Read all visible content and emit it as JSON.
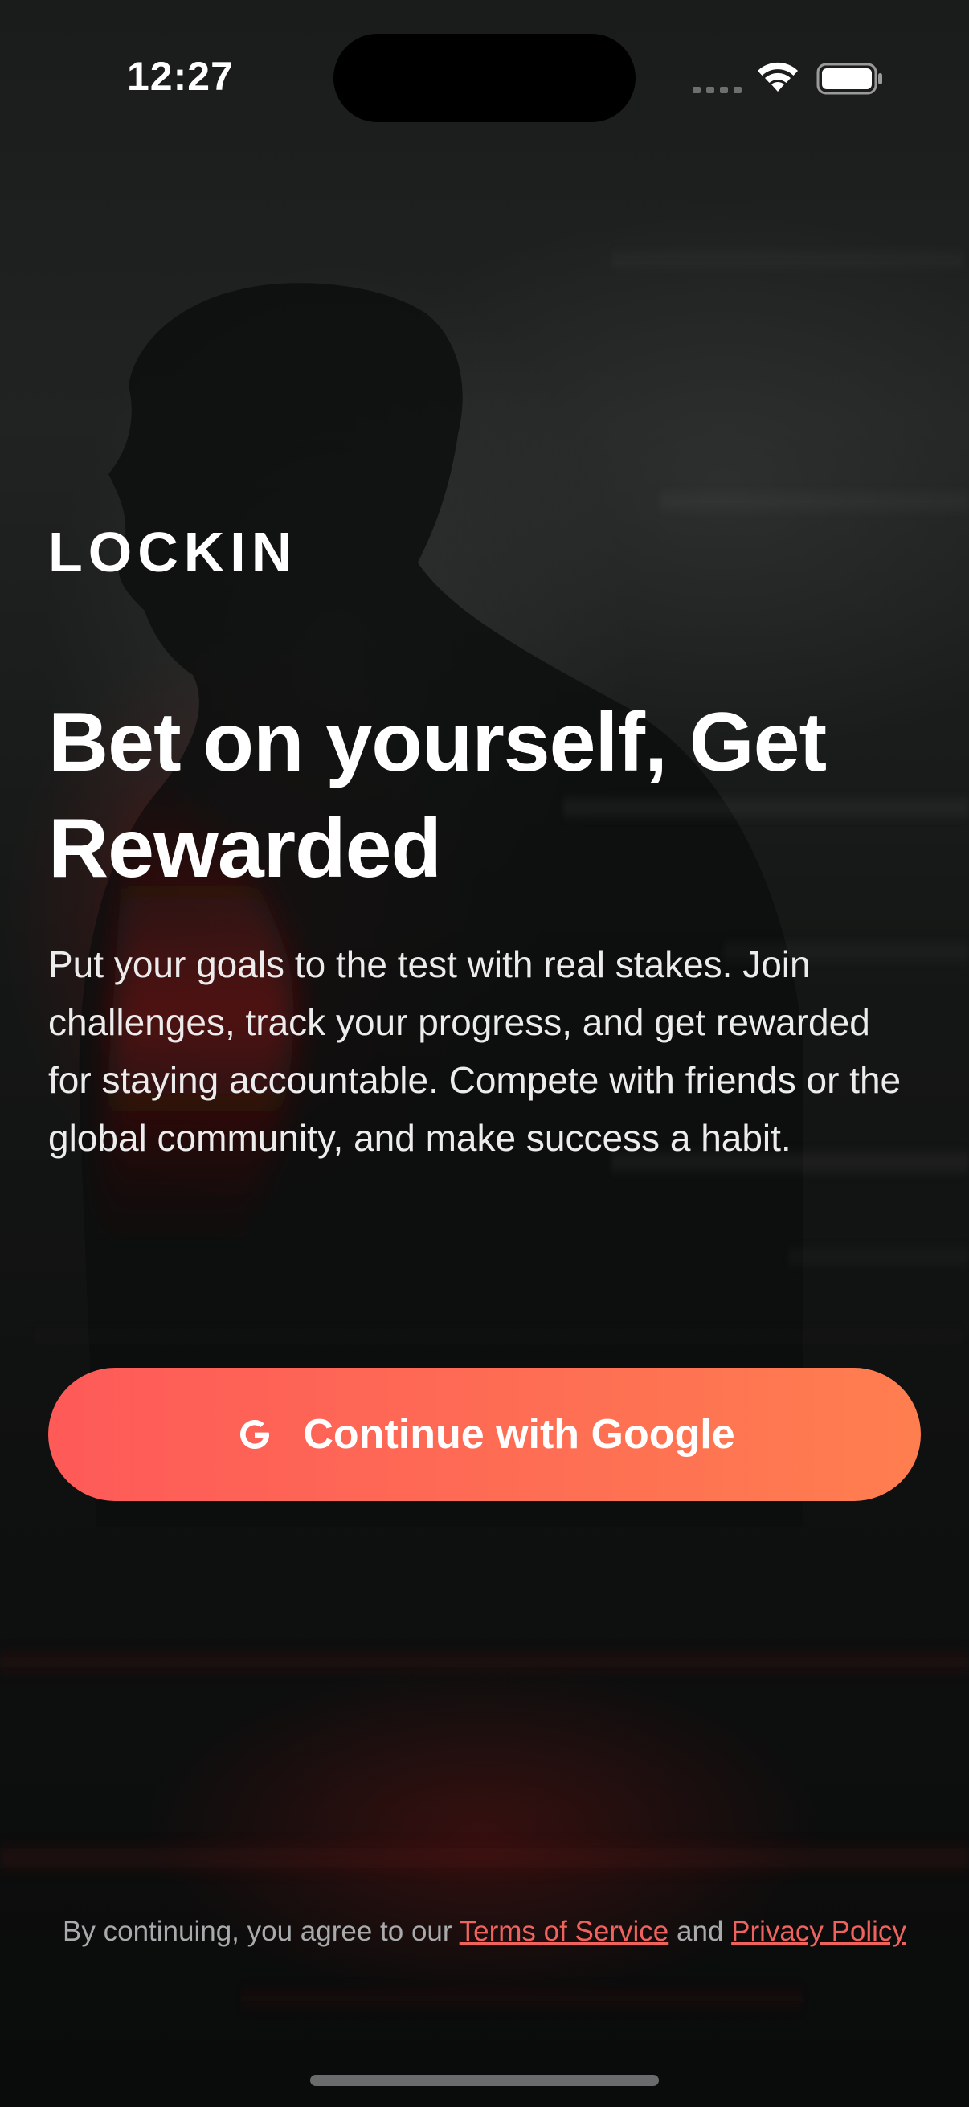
{
  "status_bar": {
    "time": "12:27",
    "icons": [
      "cellular-signal-icon",
      "wifi-icon",
      "battery-icon"
    ]
  },
  "brand": {
    "name": "LOCKIN"
  },
  "hero": {
    "headline": "Bet on yourself, Get Rewarded",
    "description": "Put your goals to the test with real stakes. Join challenges, track your progress, and get rewarded for staying accountable. Compete with friends or the global community, and make success a habit."
  },
  "auth": {
    "google_button_label": "Continue with Google",
    "google_icon": "google-g-icon"
  },
  "legal": {
    "prefix": "By continuing, you agree to our ",
    "terms_label": "Terms of Service",
    "conjunction": " and ",
    "privacy_label": "Privacy Policy"
  },
  "colors": {
    "accent_start": "#fe5a58",
    "accent_end": "#ff7e4f",
    "link": "#f0625e",
    "text_primary": "#ffffff",
    "text_secondary": "#a8aaac",
    "background": "#0b0c0d"
  }
}
